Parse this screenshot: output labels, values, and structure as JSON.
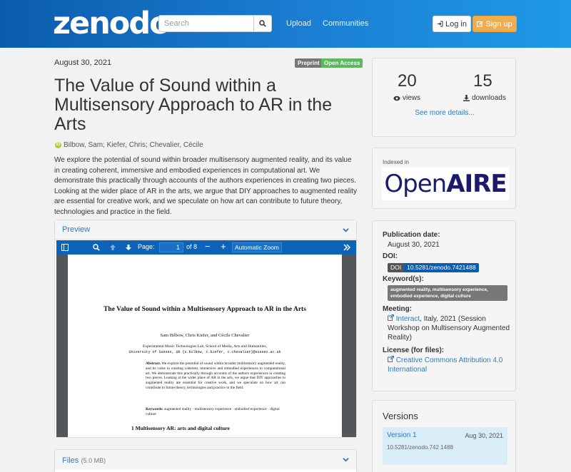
{
  "header": {
    "logo": "zenodo",
    "search_placeholder": "Search",
    "nav": [
      "Upload",
      "Communities"
    ],
    "login_label": "Log in",
    "signup_label": "Sign up"
  },
  "record": {
    "date": "August 30, 2021",
    "badges": [
      "Preprint",
      "Open Access"
    ],
    "title": "The Value of Sound within a Multisensory Approach to AR in the Arts",
    "authors": "Bilbow, Sam; Kiefer, Chris; Chevalier, Cécile",
    "abstract": "We explore the potential of sound within broader multisensory augmented reality, and its value in creating coherent, immersive and embodied experiences in computational art. We demonstrate this practically through accounts of the authors experiences in creating two pieces. Looking at the wider place of AR in the arts, we argue that DIY approaches to augmented reality are essential for creative work, and we speculate on how art can contribute to future theory, technologies and practice in the field."
  },
  "preview": {
    "label": "Preview",
    "toolbar": {
      "page_label": "Page:",
      "page_value": "1",
      "page_total": "of 8",
      "zoom": "Automatic Zoom"
    },
    "pdf": {
      "title": "The Value of Sound within a Multisensory Approach to AR in the Arts",
      "authors": "Sam Bilbow, Chris Kiefer, and Cécile Chevalier",
      "affiliation_1": "Experimental Music Technologies Lab, School of Media, Arts and Humanities,",
      "affiliation_2": "University of Sussex, UK {s.bilbow, c.kiefer, c.chevalier}@sussex.ac.uk",
      "abstract_label": "Abstract.",
      "abstract_text": "We explore the potential of sound within broader multisensory augmented reality, and its value in creating coherent, immersive and embodied experiences in computational art. We demonstrate this practically through accounts of the authors experiences in creating two pieces. Looking at the wider place of AR in the arts, we argue that DIY approaches to augmented reality are essential for creative work, and we speculate on how art can contribute to future theory, technologies and practice in the field.",
      "keywords_label": "Keywords:",
      "keywords_text": "augmented reality · multisensory experience · embodied experience · digital culture",
      "section_heading": "1   Multisensory AR: arts and digital culture"
    }
  },
  "files": {
    "label": "Files",
    "size": "(5.0 MB)"
  },
  "stats": {
    "views": "20",
    "views_label": "views",
    "downloads": "15",
    "downloads_label": "downloads",
    "see_more": "See more details..."
  },
  "indexed": {
    "label": "Indexed in",
    "logo_part1": "Open",
    "logo_part2": "AIRE"
  },
  "metadata": {
    "pub_date_label": "Publication date:",
    "pub_date": "August 30, 2021",
    "doi_label": "DOI:",
    "doi_badge_left": "DOI",
    "doi_badge_right": "10.5281/zenodo.7421488",
    "keywords_label": "Keyword(s):",
    "keywords": "augmented reality, multisensory experience, embodied experience, digital culture",
    "meeting_label": "Meeting:",
    "meeting_link": "Interact",
    "meeting_text": ", Italy, 2021 (Session Workshop on Multisensory Augmented Reality)",
    "license_label": "License (for files):",
    "license_link": "Creative Commons Attribution 4.0 International"
  },
  "versions": {
    "title": "Versions",
    "items": [
      {
        "name": "Version 1",
        "date": "Aug 30, 2021",
        "doi": "10.5281/zenodo.742 1488"
      }
    ]
  }
}
